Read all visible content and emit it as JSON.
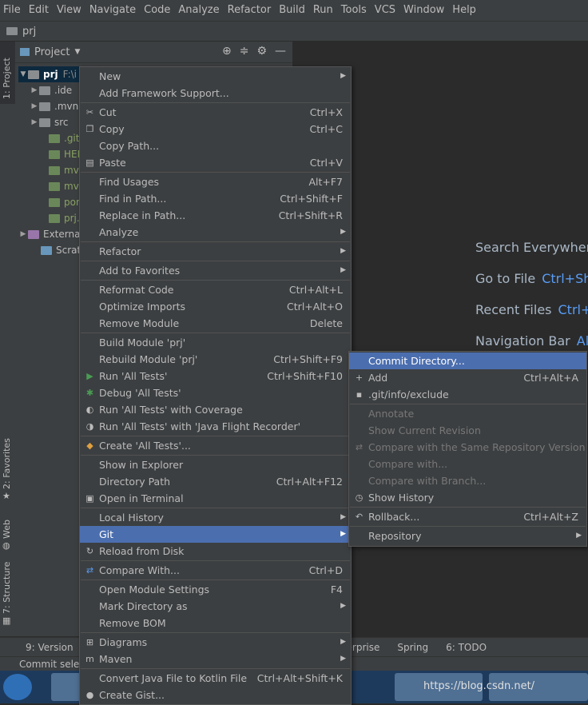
{
  "menubar": [
    "File",
    "Edit",
    "View",
    "Navigate",
    "Code",
    "Analyze",
    "Refactor",
    "Build",
    "Run",
    "Tools",
    "VCS",
    "Window",
    "Help"
  ],
  "navbar": {
    "project": "prj"
  },
  "leftstrip": {
    "project_tab": "1: Project",
    "favorites_tab": "2: Favorites",
    "web_tab": "Web",
    "structure_tab": "7: Structure"
  },
  "project_panel": {
    "title": "Project",
    "tree": [
      {
        "label": "prj",
        "suffix": "F:\\i",
        "type": "root"
      },
      {
        "label": ".ide",
        "type": "folder"
      },
      {
        "label": ".mvn",
        "type": "folder"
      },
      {
        "label": "src",
        "type": "folder"
      },
      {
        "label": ".gitig",
        "type": "file"
      },
      {
        "label": "HEL",
        "type": "file"
      },
      {
        "label": "mvn",
        "type": "file"
      },
      {
        "label": "mvn",
        "type": "file"
      },
      {
        "label": "pom",
        "type": "file"
      },
      {
        "label": "prj.i",
        "type": "file"
      },
      {
        "label": "Externa",
        "type": "lib"
      },
      {
        "label": "Scratch",
        "type": "scratch"
      }
    ]
  },
  "editor_hints": [
    {
      "label": "Search Everywhere",
      "key": ""
    },
    {
      "label": "Go to File",
      "key": "Ctrl+Sh"
    },
    {
      "label": "Recent Files",
      "key": "Ctrl+"
    },
    {
      "label": "Navigation Bar",
      "key": "Alt"
    }
  ],
  "context_menu": [
    {
      "label": "New",
      "shortcut": "",
      "submenu": true,
      "icon": ""
    },
    {
      "label": "Add Framework Support...",
      "shortcut": "",
      "icon": ""
    },
    {
      "sep": true
    },
    {
      "label": "Cut",
      "shortcut": "Ctrl+X",
      "icon": "✂"
    },
    {
      "label": "Copy",
      "shortcut": "Ctrl+C",
      "icon": "❐"
    },
    {
      "label": "Copy Path...",
      "shortcut": "",
      "icon": ""
    },
    {
      "label": "Paste",
      "shortcut": "Ctrl+V",
      "icon": "▤"
    },
    {
      "sep": true
    },
    {
      "label": "Find Usages",
      "shortcut": "Alt+F7",
      "icon": ""
    },
    {
      "label": "Find in Path...",
      "shortcut": "Ctrl+Shift+F",
      "icon": ""
    },
    {
      "label": "Replace in Path...",
      "shortcut": "Ctrl+Shift+R",
      "icon": ""
    },
    {
      "label": "Analyze",
      "shortcut": "",
      "submenu": true,
      "icon": ""
    },
    {
      "sep": true
    },
    {
      "label": "Refactor",
      "shortcut": "",
      "submenu": true,
      "icon": ""
    },
    {
      "sep": true
    },
    {
      "label": "Add to Favorites",
      "shortcut": "",
      "submenu": true,
      "icon": ""
    },
    {
      "sep": true
    },
    {
      "label": "Reformat Code",
      "shortcut": "Ctrl+Alt+L",
      "icon": ""
    },
    {
      "label": "Optimize Imports",
      "shortcut": "Ctrl+Alt+O",
      "icon": ""
    },
    {
      "label": "Remove Module",
      "shortcut": "Delete",
      "icon": ""
    },
    {
      "sep": true
    },
    {
      "label": "Build Module 'prj'",
      "shortcut": "",
      "icon": ""
    },
    {
      "label": "Rebuild Module 'prj'",
      "shortcut": "Ctrl+Shift+F9",
      "icon": ""
    },
    {
      "label": "Run 'All Tests'",
      "shortcut": "Ctrl+Shift+F10",
      "icon": "▶"
    },
    {
      "label": "Debug 'All Tests'",
      "shortcut": "",
      "icon": "✱"
    },
    {
      "label": "Run 'All Tests' with Coverage",
      "shortcut": "",
      "icon": "◐"
    },
    {
      "label": "Run 'All Tests' with 'Java Flight Recorder'",
      "shortcut": "",
      "icon": "◑"
    },
    {
      "sep": true
    },
    {
      "label": "Create 'All Tests'...",
      "shortcut": "",
      "icon": "◆"
    },
    {
      "sep": true
    },
    {
      "label": "Show in Explorer",
      "shortcut": "",
      "icon": ""
    },
    {
      "label": "Directory Path",
      "shortcut": "Ctrl+Alt+F12",
      "icon": ""
    },
    {
      "label": "Open in Terminal",
      "shortcut": "",
      "icon": "▣"
    },
    {
      "sep": true
    },
    {
      "label": "Local History",
      "shortcut": "",
      "submenu": true,
      "icon": ""
    },
    {
      "label": "Git",
      "shortcut": "",
      "submenu": true,
      "icon": "",
      "highlight": true
    },
    {
      "label": "Reload from Disk",
      "shortcut": "",
      "icon": "↻"
    },
    {
      "sep": true
    },
    {
      "label": "Compare With...",
      "shortcut": "Ctrl+D",
      "icon": "⇄"
    },
    {
      "sep": true
    },
    {
      "label": "Open Module Settings",
      "shortcut": "F4",
      "icon": ""
    },
    {
      "label": "Mark Directory as",
      "shortcut": "",
      "submenu": true,
      "icon": ""
    },
    {
      "label": "Remove BOM",
      "shortcut": "",
      "icon": ""
    },
    {
      "sep": true
    },
    {
      "label": "Diagrams",
      "shortcut": "",
      "submenu": true,
      "icon": "⊞"
    },
    {
      "label": "Maven",
      "shortcut": "",
      "submenu": true,
      "icon": "m"
    },
    {
      "sep": true
    },
    {
      "label": "Convert Java File to Kotlin File",
      "shortcut": "Ctrl+Alt+Shift+K",
      "icon": ""
    },
    {
      "label": "Create Gist...",
      "shortcut": "",
      "icon": "●"
    }
  ],
  "git_submenu": [
    {
      "label": "Commit Directory...",
      "shortcut": "",
      "icon": "",
      "highlight": true
    },
    {
      "label": "Add",
      "shortcut": "Ctrl+Alt+A",
      "icon": "+"
    },
    {
      "label": ".git/info/exclude",
      "shortcut": "",
      "icon": "▪"
    },
    {
      "sep": true
    },
    {
      "label": "Annotate",
      "shortcut": "",
      "icon": "",
      "disabled": true
    },
    {
      "label": "Show Current Revision",
      "shortcut": "",
      "icon": "",
      "disabled": true
    },
    {
      "label": "Compare with the Same Repository Version",
      "shortcut": "",
      "icon": "⇄",
      "disabled": true
    },
    {
      "label": "Compare with...",
      "shortcut": "",
      "icon": "",
      "disabled": true
    },
    {
      "label": "Compare with Branch...",
      "shortcut": "",
      "icon": "",
      "disabled": true
    },
    {
      "label": "Show History",
      "shortcut": "",
      "icon": "◷"
    },
    {
      "sep": true
    },
    {
      "label": "Rollback...",
      "shortcut": "Ctrl+Alt+Z",
      "icon": "↶"
    },
    {
      "sep": true
    },
    {
      "label": "Repository",
      "shortcut": "",
      "submenu": true,
      "icon": ""
    }
  ],
  "bottombar": [
    "9: Version",
    "Enterprise",
    "Spring",
    "6: TODO"
  ],
  "statusbar": {
    "text": "Commit selec"
  },
  "taskbar": {
    "watermark": "https://blog.csdn.net/"
  },
  "colors": {
    "highlight": "#4b6eaf",
    "panel": "#3c3f41",
    "editor": "#2b2b2b",
    "link": "#589df6"
  }
}
